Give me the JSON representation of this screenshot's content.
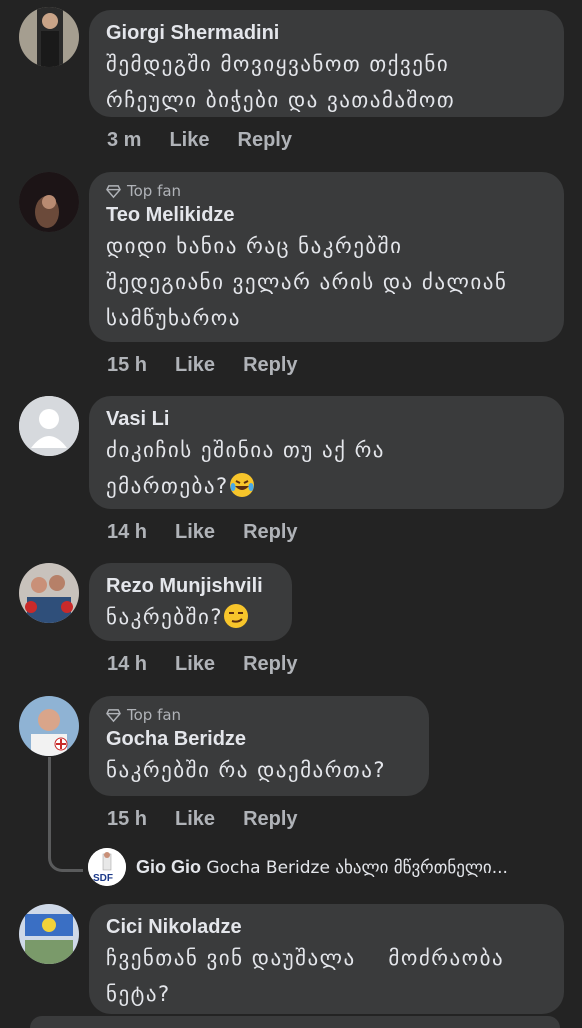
{
  "comments": [
    {
      "name": "Giorgi Shermadini",
      "badge": "",
      "lines": [
        "შემდეგში მოვიყვანოთ თქვენი",
        "რჩეული ბიჭები და ვათამაშოთ"
      ],
      "time": "3 m",
      "like": "Like",
      "reply": "Reply"
    },
    {
      "name": "Teo Melikidze",
      "badge": "Top fan",
      "lines": [
        "დიდი ხანია რაც ნაკრებში",
        "შედეგიანი ველარ არის და ძალიან",
        "სამწუხაროა"
      ],
      "time": "15 h",
      "like": "Like",
      "reply": "Reply"
    },
    {
      "name": "Vasi Li",
      "badge": "",
      "lines": [
        "ძიკიჩის ეშინია თუ აქ რა",
        "ემართება?"
      ],
      "time": "14 h",
      "like": "Like",
      "reply": "Reply"
    },
    {
      "name": "Rezo Munjishvili",
      "badge": "",
      "lines": [
        "ნაკრებში?"
      ],
      "time": "14 h",
      "like": "Like",
      "reply": "Reply"
    },
    {
      "name": "Gocha Beridze",
      "badge": "Top fan",
      "lines": [
        "ნაკრებში რა დაემართა?"
      ],
      "time": "15 h",
      "like": "Like",
      "reply": "Reply"
    },
    {
      "name": "Cici Nikoladze",
      "badge": "",
      "lines": [
        "ჩვენთან ვინ დაუშალა    მოძრაობა",
        "ნეტა?"
      ]
    }
  ],
  "reply_preview": {
    "name": "Gio Gio",
    "text": "Gocha Beridze ახალი მწვრთნელი..."
  },
  "icons": {
    "badge": "diamond-icon",
    "laugh_emoji": "laughing-tears-emoji",
    "smirk_emoji": "smirk-emoji"
  },
  "colors": {
    "background": "#232323",
    "bubble": "#3a3b3c",
    "text": "#e4e6eb",
    "meta": "#b0b3b8"
  }
}
